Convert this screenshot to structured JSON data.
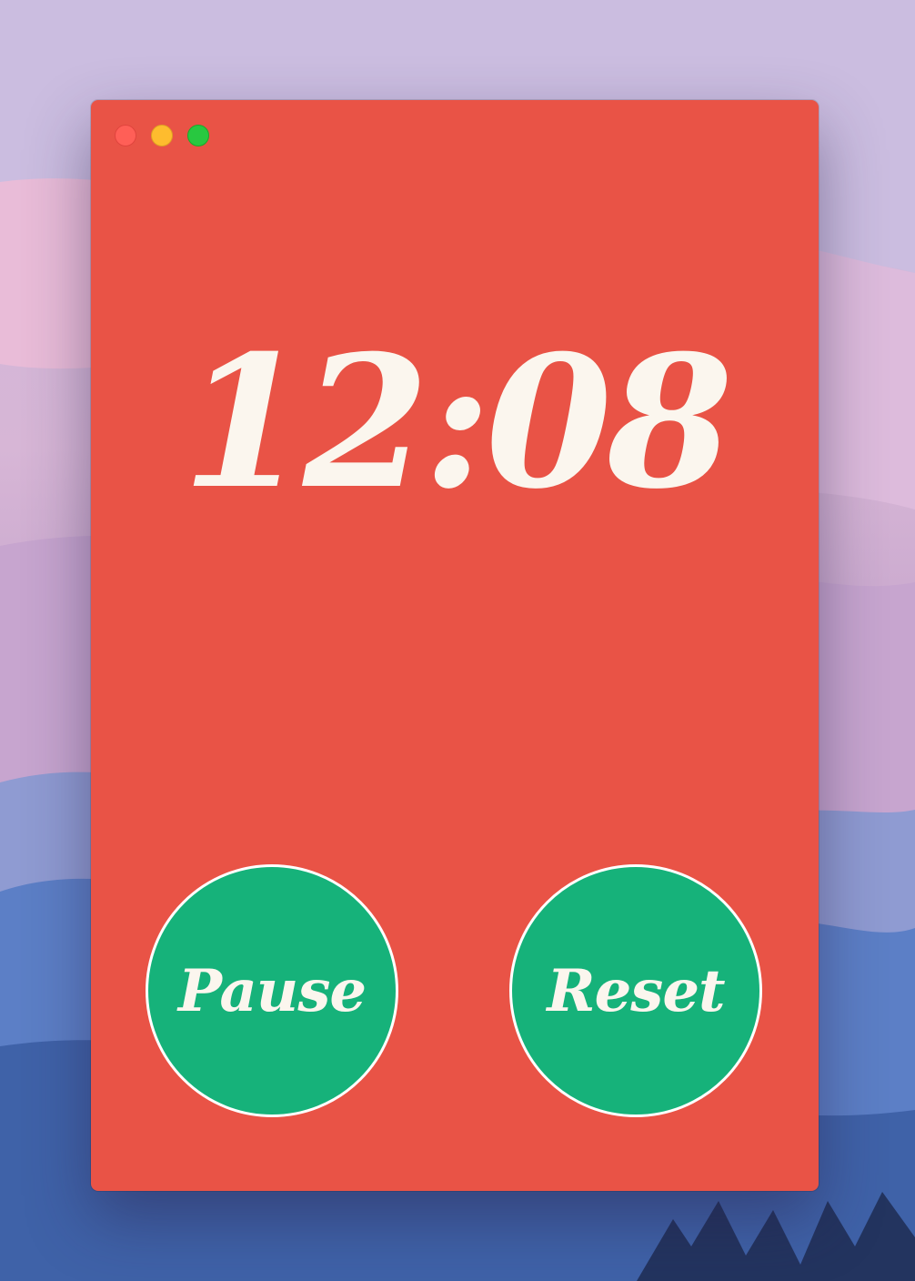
{
  "window": {
    "background": "#e95346"
  },
  "timer": {
    "value": "12:08",
    "color": "#fbf6ee"
  },
  "buttons": {
    "pause_label": "Pause",
    "reset_label": "Reset",
    "background": "#16b27a",
    "text_color": "#fbf6ee"
  },
  "traffic_lights": [
    "close",
    "minimize",
    "maximize"
  ]
}
